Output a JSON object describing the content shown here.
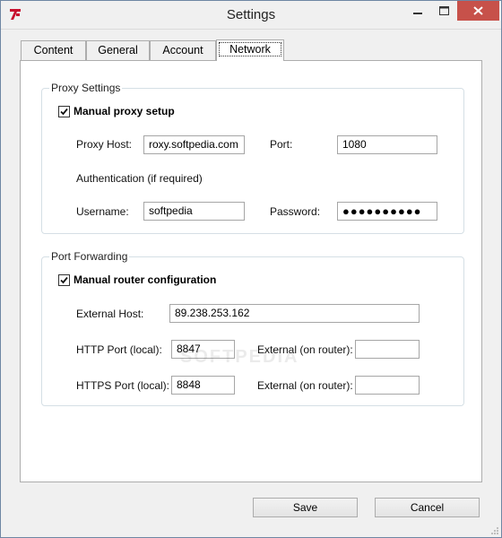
{
  "window": {
    "title": "Settings",
    "colors": {
      "close_button": "#c7514a",
      "frame": "#6e86a3",
      "app_icon": "#c8102e"
    }
  },
  "tabs": [
    {
      "label": "Content",
      "active": false
    },
    {
      "label": "General",
      "active": false
    },
    {
      "label": "Account",
      "active": false
    },
    {
      "label": "Network",
      "active": true
    }
  ],
  "proxy": {
    "legend": "Proxy Settings",
    "manual_label": "Manual proxy setup",
    "manual_checked": true,
    "host_label": "Proxy Host:",
    "host_value": "roxy.softpedia.com",
    "port_label": "Port:",
    "port_value": "1080",
    "auth_label": "Authentication (if required)",
    "username_label": "Username:",
    "username_value": "softpedia",
    "password_label": "Password:",
    "password_value": "●●●●●●●●●●"
  },
  "forwarding": {
    "legend": "Port Forwarding",
    "manual_label": "Manual router configuration",
    "manual_checked": true,
    "external_host_label": "External Host:",
    "external_host_value": "89.238.253.162",
    "http_label": "HTTP Port (local):",
    "http_value": "8847",
    "http_ext_label": "External (on router):",
    "http_ext_value": "",
    "https_label": "HTTPS Port (local):",
    "https_value": "8848",
    "https_ext_label": "External (on router):",
    "https_ext_value": ""
  },
  "buttons": {
    "save": "Save",
    "cancel": "Cancel"
  },
  "watermark": "SOFTPEDIA"
}
